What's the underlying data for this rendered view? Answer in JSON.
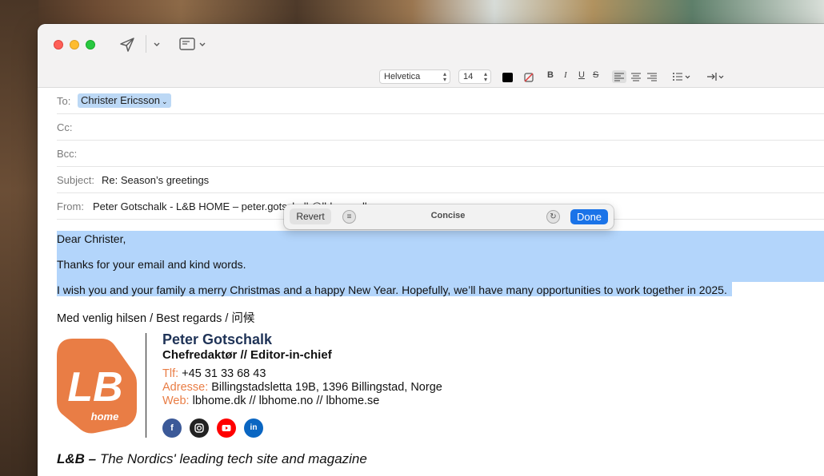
{
  "colors": {
    "accent": "#1a73e8",
    "selection": "#b3d5fb",
    "brand_orange": "#e97d45",
    "brand_navy": "#1f3357",
    "facebook": "#3b5998",
    "instagram": "#222222",
    "youtube": "#ff0000",
    "linkedin": "#0a66c2"
  },
  "toolbar": {
    "send_icon": "paper-plane-icon",
    "header_fields_icon": "header-fields-icon"
  },
  "format": {
    "font": "Helvetica",
    "size": "14",
    "bold": "B",
    "italic": "I",
    "underline": "U",
    "strikethrough": "S"
  },
  "header": {
    "to_label": "To:",
    "to_recipient": "Christer Ericsson",
    "cc_label": "Cc:",
    "bcc_label": "Bcc:",
    "subject_label": "Subject:",
    "subject_value": "Re: Season’s greetings",
    "from_label": "From:",
    "from_value": "Peter Gotschalk - L&B HOME – peter.gotschalk@lbhome.dk"
  },
  "writing_tools": {
    "revert_label": "Revert",
    "title": "Concise",
    "done_label": "Done"
  },
  "message": {
    "greeting": "Dear Christer,",
    "line1": "Thanks for your email and kind words.",
    "line2": "I wish you and your family a merry Christmas and a happy New Year. Hopefully, we’ll have many opportunities to work together in 2025.",
    "closing": "Med venlig hilsen / Best regards / 问候"
  },
  "signature": {
    "name": "Peter Gotschalk",
    "role": "Chefredaktør // Editor-in-chief",
    "phone_label": "Tlf:",
    "phone": "+45 31 33 68 43",
    "address_label": "Adresse:",
    "address": "Billingstadsletta 19B, 1396 Billingstad, Norge",
    "web_label": "Web:",
    "web": "lbhome.dk // lbhome.no // lbhome.se",
    "logo_letters": "LB",
    "logo_word": "home",
    "tagline_brand": "L&B –",
    "tagline_text": " The Nordics' leading tech site and magazine",
    "social": [
      "facebook-icon",
      "instagram-icon",
      "youtube-icon",
      "linkedin-icon"
    ]
  }
}
